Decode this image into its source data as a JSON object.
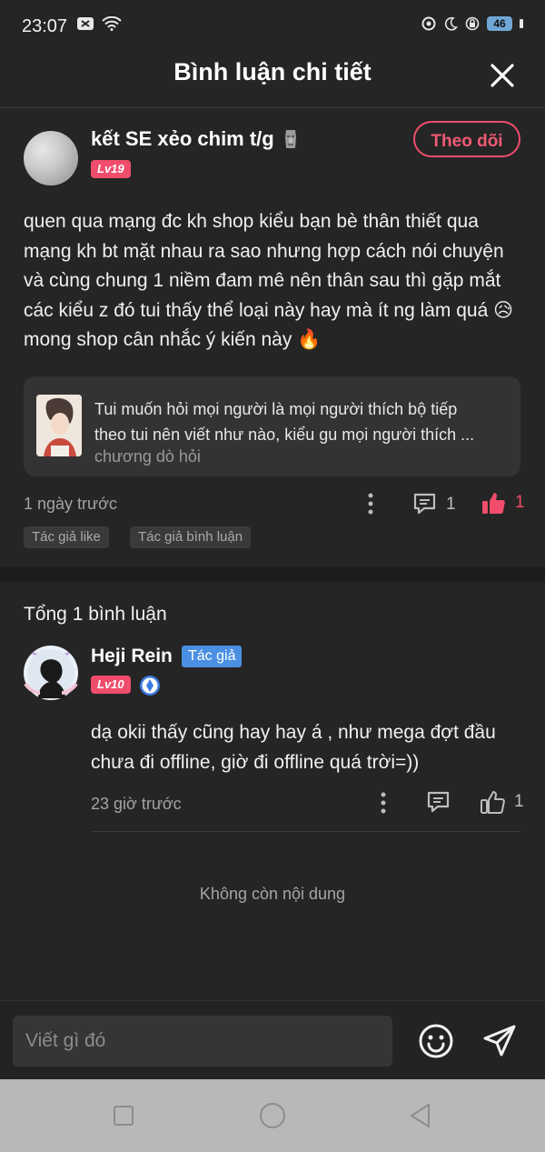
{
  "status_bar": {
    "time": "23:07",
    "battery": "46"
  },
  "header": {
    "title": "Bình luận chi tiết"
  },
  "comment": {
    "username": "kết SE xẻo chim t/g",
    "level": "Lv19",
    "follow_label": "Theo dõi",
    "body": "quen qua mạng đc kh shop kiểu bạn bè thân thiết qua mạng kh bt mặt nhau ra sao nhưng hợp cách nói chuyện và cùng chung 1 niềm đam mê nên thân sau thì gặp mắt các kiểu z đó tui thấy thể loại này hay mà ít ng làm quá 😥 mong shop cân nhắc ý kiến này 🔥",
    "quote": {
      "line1": "Tui muốn hỏi mọi người là mọi người thích bộ tiếp",
      "line2": "theo tui nên viết như nào, kiểu gu mọi người thích ...",
      "chapter": "chương dò hỏi"
    },
    "time": "1 ngày trước",
    "reply_count": "1",
    "like_count": "1",
    "tags": [
      "Tác giả like",
      "Tác giả bình luận"
    ]
  },
  "replies": {
    "total_label": "Tổng 1 bình luận",
    "items": [
      {
        "username": "Heji Rein",
        "author_badge": "Tác giả",
        "level": "Lv10",
        "body": "dạ okii thấy cũng hay hay á , như mega đợt đầu chưa đi offline, giờ đi offline quá trời=))",
        "time": "23 giờ trước",
        "like_count": "1"
      }
    ],
    "end_label": "Không còn nội dung"
  },
  "input": {
    "placeholder": "Viết gì đó"
  },
  "colors": {
    "accent": "#ef4d6b",
    "author_badge": "#4a90e2",
    "background": "#252525"
  },
  "icons": [
    "close-icon",
    "more-icon",
    "comment-icon",
    "like-icon",
    "emoji-icon",
    "send-icon",
    "nav-recent-icon",
    "nav-home-icon",
    "nav-back-icon"
  ]
}
